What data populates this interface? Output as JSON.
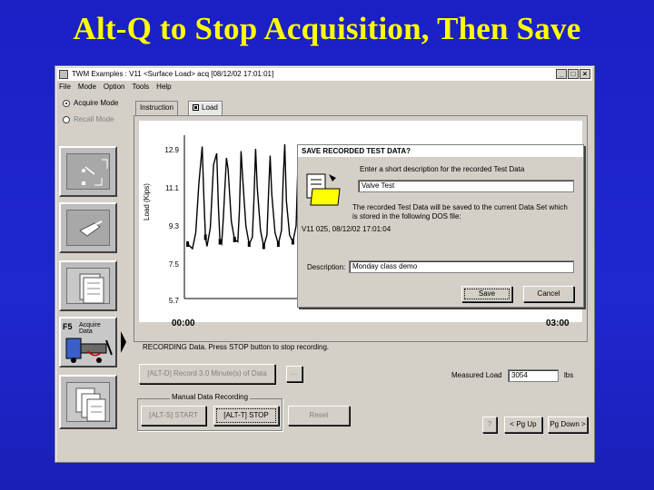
{
  "slide": {
    "title": "Alt-Q to Stop Acquisition, Then Save"
  },
  "window": {
    "title": "TWM    Examples : V11   <Surface Load> acq  [08/12/02 17:01:01]",
    "controls": {
      "minimize": "_",
      "maximize": "□",
      "close": "×"
    }
  },
  "menu": {
    "items": [
      "File",
      "Mode",
      "Option",
      "Tools",
      "Help"
    ]
  },
  "modes": {
    "acquire": "Acquire Mode",
    "recall": "Recall Mode"
  },
  "side": {
    "f5_label": "F5",
    "acquire_data_label": "Acquire Data"
  },
  "tabs": {
    "instruction": "Instruction",
    "load": "Load"
  },
  "chart_data": {
    "type": "line",
    "ylabel": "Load (Kips)",
    "yticks": [
      "12.9",
      "11.1",
      "9.3",
      "7.5",
      "5.7"
    ],
    "ylim": [
      5.7,
      12.9
    ],
    "xticks": [
      "00:00",
      "03:00"
    ],
    "series": [
      {
        "x": [
          0.02,
          0.05,
          0.07,
          0.09,
          0.11,
          0.12,
          0.13,
          0.14,
          0.16,
          0.18,
          0.2,
          0.21,
          0.22,
          0.23,
          0.24,
          0.26,
          0.27,
          0.29,
          0.31,
          0.33,
          0.34,
          0.35,
          0.36,
          0.38,
          0.4,
          0.42,
          0.43,
          0.44,
          0.45,
          0.47,
          0.49,
          0.51,
          0.52,
          0.53,
          0.54,
          0.56,
          0.58,
          0.6,
          0.61,
          0.62,
          0.63,
          0.65,
          0.67,
          0.69,
          0.7,
          0.71,
          0.72,
          0.74,
          0.76,
          0.78,
          0.79,
          0.8,
          0.81,
          0.83,
          0.85,
          0.87,
          0.88,
          0.89,
          0.9,
          0.92,
          0.94,
          0.96,
          0.97,
          0.98,
          1.0
        ],
        "y": [
          8.1,
          7.9,
          8.6,
          10.8,
          12.4,
          10.2,
          8.4,
          8.0,
          8.8,
          11.6,
          12.1,
          9.8,
          8.2,
          8.1,
          9.2,
          11.9,
          11.4,
          9.1,
          8.3,
          8.2,
          9.6,
          12.2,
          11.0,
          8.9,
          8.1,
          8.4,
          10.1,
          12.3,
          10.6,
          8.7,
          8.0,
          8.5,
          10.4,
          12.0,
          10.3,
          8.6,
          8.1,
          8.7,
          10.9,
          12.5,
          10.0,
          8.5,
          8.2,
          8.9,
          11.2,
          12.1,
          9.7,
          8.4,
          8.1,
          9.0,
          11.5,
          11.8,
          9.4,
          8.3,
          8.2,
          9.4,
          11.7,
          11.6,
          9.2,
          8.2,
          8.3,
          9.9,
          12.0,
          10.5,
          8.6
        ]
      }
    ]
  },
  "dialog": {
    "title": "SAVE RECORDED TEST DATA?",
    "prompt": "Enter a short description for the recorded Test Data",
    "description_value": "Valve Test",
    "info_line1": "The recorded Test Data will be saved to the current Data Set which",
    "info_line2": "is stored in the following DOS file:",
    "file_path": "V11 025, 08/12/02 17:01:04",
    "desc_label": "Description:",
    "desc2_value": "Monday class demo",
    "save_label": "Save",
    "cancel_label": "Cancel"
  },
  "status": {
    "recording": "RECORDING Data. Press STOP button to stop recording."
  },
  "controls": {
    "record_label": "[ALT-D] Record 3.0 Minute(s) of Data",
    "ellipsis_label": "...",
    "measured_load_label": "Measured Load",
    "measured_load_value": "3054",
    "unit": "lbs",
    "manual_group_label": "Manual Data Recording",
    "start_label": "[ALT-S] START",
    "stop_label": "[ALT-T] STOP",
    "reset_label": "Reset",
    "help_label": "?",
    "up_label": "< Pg Up",
    "down_label": "Pg Down >"
  }
}
